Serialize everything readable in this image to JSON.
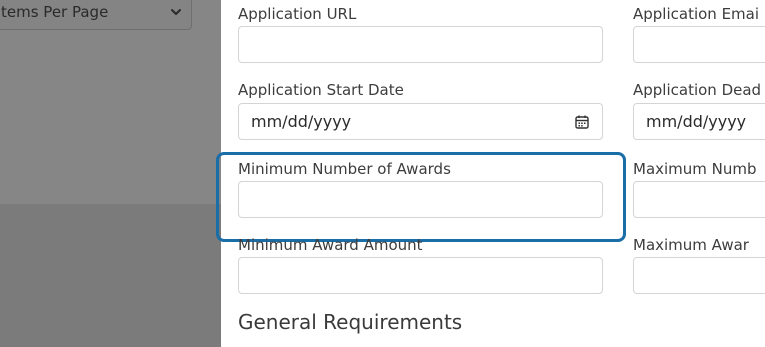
{
  "backdrop": {
    "items_per_page": {
      "label": "tems Per Page"
    }
  },
  "form": {
    "application_url": {
      "label": "Application URL",
      "value": ""
    },
    "application_email": {
      "label": "Application Emai",
      "value": ""
    },
    "application_start_date": {
      "label": "Application Start Date",
      "placeholder": "mm/dd/yyyy"
    },
    "application_deadline": {
      "label": "Application Dead",
      "placeholder": "mm/dd/yyyy"
    },
    "minimum_number_of_awards": {
      "label": "Minimum Number of Awards",
      "value": "",
      "focused": true
    },
    "maximum_number_of_awards": {
      "label": "Maximum Numb",
      "value": ""
    },
    "minimum_award_amount": {
      "label": "Minimum Award Amount",
      "value": ""
    },
    "maximum_award_amount": {
      "label": "Maximum Awar",
      "value": ""
    },
    "section_heading": "General Requirements"
  },
  "colors": {
    "focus_ring": "#1a6ea8",
    "backdrop": "#7b7b7b",
    "field_border": "#d4d4d4"
  },
  "icons": {
    "date_picker": "calendar-icon",
    "select": "chevron-down-icon"
  }
}
